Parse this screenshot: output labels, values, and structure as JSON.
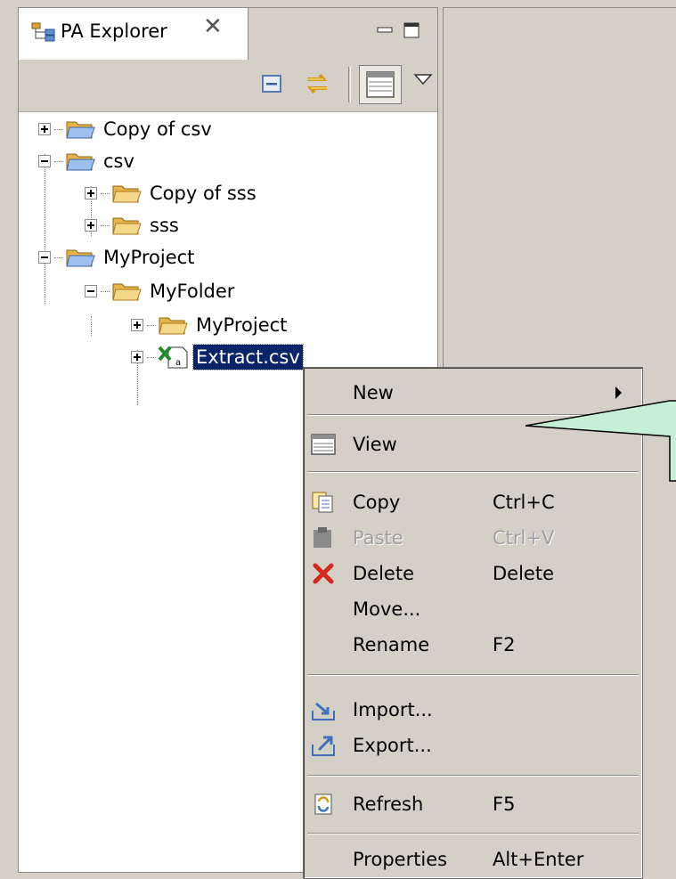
{
  "explorer": {
    "tab_title": "PA Explorer",
    "tab_icon": "pa-explorer-icon",
    "close_icon": "close-icon",
    "minimize_icon": "minimize-icon",
    "maximize_icon": "maximize-icon",
    "toolbar": {
      "collapse_all_icon": "collapse-all-icon",
      "link_with_editor_icon": "link-with-editor-icon",
      "view_icon": "table-view-icon",
      "view_menu_icon": "view-menu-icon"
    },
    "tree": [
      {
        "label": "Copy of csv",
        "icon": "folder-icon",
        "expanded": false
      },
      {
        "label": "csv",
        "icon": "folder-icon",
        "expanded": true
      },
      {
        "label": "Copy of sss",
        "icon": "folder-icon",
        "expanded": false
      },
      {
        "label": "sss",
        "icon": "folder-icon",
        "expanded": false
      },
      {
        "label": "MyProject",
        "icon": "folder-icon",
        "expanded": true
      },
      {
        "label": "MyFolder",
        "icon": "folder-icon",
        "expanded": true
      },
      {
        "label": "MyProject",
        "icon": "folder-icon",
        "expanded": false
      },
      {
        "label": "Extract.csv",
        "icon": "csv-file-icon",
        "expanded": false,
        "selected": true
      }
    ]
  },
  "context_menu": {
    "items": [
      {
        "label": "New",
        "accel": "",
        "icon": "",
        "submenu": true
      },
      {
        "label": "View",
        "accel": "",
        "icon": "table-view-icon"
      },
      {
        "label": "Copy",
        "accel": "Ctrl+C",
        "icon": "copy-icon"
      },
      {
        "label": "Paste",
        "accel": "Ctrl+V",
        "icon": "paste-icon",
        "disabled": true
      },
      {
        "label": "Delete",
        "accel": "Delete",
        "icon": "delete-icon"
      },
      {
        "label": "Move...",
        "accel": "",
        "icon": ""
      },
      {
        "label": "Rename",
        "accel": "F2",
        "icon": ""
      },
      {
        "label": "Import...",
        "accel": "",
        "icon": "import-icon"
      },
      {
        "label": "Export...",
        "accel": "",
        "icon": "export-icon"
      },
      {
        "label": "Refresh",
        "accel": "F5",
        "icon": "refresh-icon"
      },
      {
        "label": "Properties",
        "accel": "Alt+Enter",
        "icon": ""
      }
    ]
  },
  "colors": {
    "selection": "#0a246a",
    "panel": "#d4d0c8",
    "callout_fill": "#c6f0d6"
  }
}
